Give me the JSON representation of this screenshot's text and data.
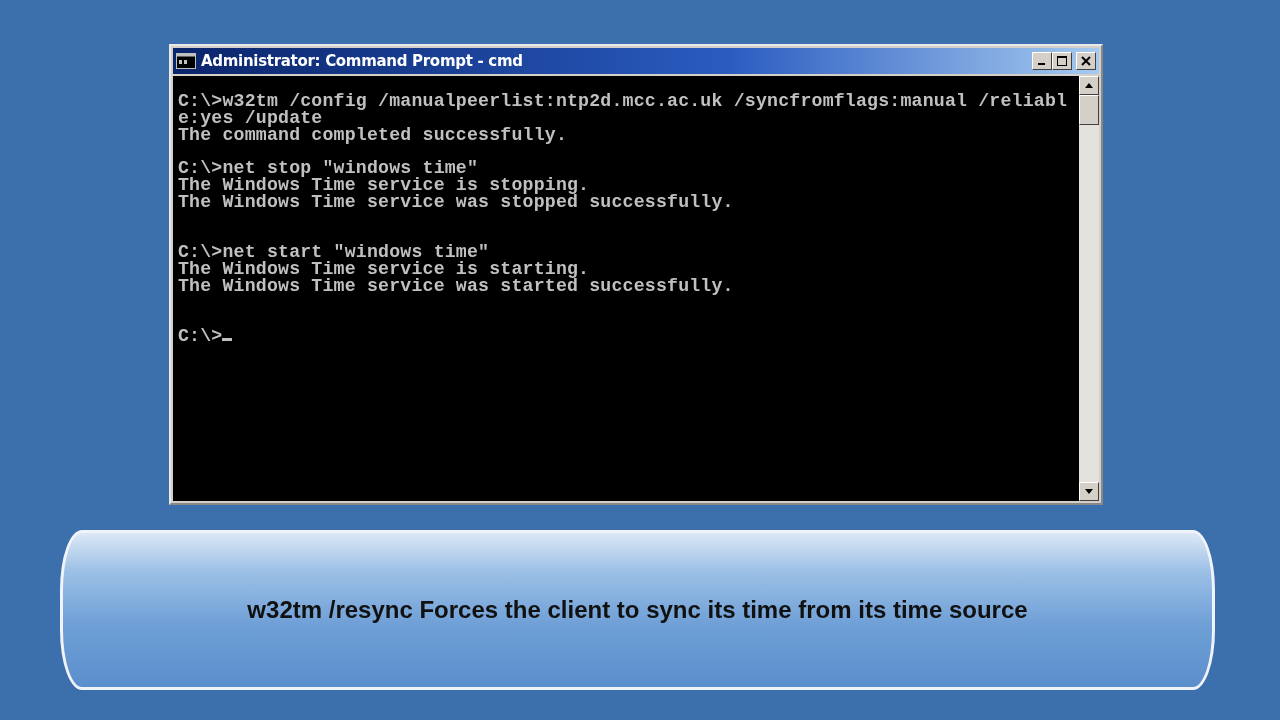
{
  "window": {
    "title": "Administrator: Command Prompt - cmd"
  },
  "console": [
    {
      "kind": "line",
      "text": "C:\\>w32tm /config /manualpeerlist:ntp2d.mcc.ac.uk /syncfromflags:manual /reliabl"
    },
    {
      "kind": "line",
      "text": "e:yes /update"
    },
    {
      "kind": "line",
      "text": "The command completed successfully."
    },
    {
      "kind": "blank"
    },
    {
      "kind": "line",
      "text": "C:\\>net stop \"windows time\""
    },
    {
      "kind": "line",
      "text": "The Windows Time service is stopping."
    },
    {
      "kind": "line",
      "text": "The Windows Time service was stopped successfully."
    },
    {
      "kind": "blank"
    },
    {
      "kind": "blank"
    },
    {
      "kind": "line",
      "text": "C:\\>net start \"windows time\""
    },
    {
      "kind": "line",
      "text": "The Windows Time service is starting."
    },
    {
      "kind": "line",
      "text": "The Windows Time service was started successfully."
    },
    {
      "kind": "blank"
    },
    {
      "kind": "blank"
    },
    {
      "kind": "prompt",
      "text": "C:\\>"
    }
  ],
  "caption": "w32tm /resync Forces the client to sync its time from its time source"
}
